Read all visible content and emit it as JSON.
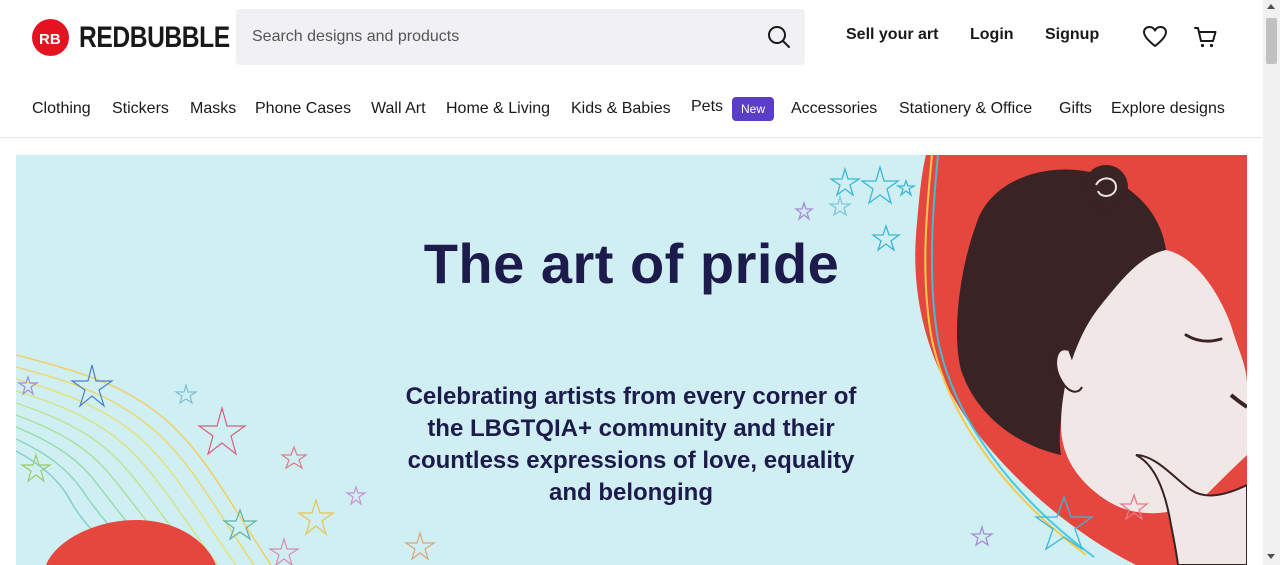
{
  "brand": {
    "wordmark": "REDBUBBLE",
    "mark_text": "RB",
    "color": "#e41321"
  },
  "search": {
    "placeholder": "Search designs and products",
    "icon": "search-icon"
  },
  "header_links": {
    "sell": "Sell your art",
    "login": "Login",
    "signup": "Signup"
  },
  "header_icons": [
    "heart-icon",
    "cart-icon"
  ],
  "categories": [
    "Clothing",
    "Stickers",
    "Masks",
    "Phone Cases",
    "Wall Art",
    "Home & Living",
    "Kids & Babies",
    "Pets",
    "Accessories",
    "Stationery & Office",
    "Gifts",
    "Explore designs"
  ],
  "pets_badge": "New",
  "hero": {
    "title": "The art of pride",
    "subtitle": "Celebrating artists from every corner of the LBGTQIA+ community and their countless expressions of love, equality and belonging",
    "background": "#cfeff2",
    "text_color": "#1d1b4c",
    "accent_red": "#e5473f"
  },
  "colors": {
    "badge": "#5a3ec8",
    "search_bg": "#f1f0f3"
  }
}
